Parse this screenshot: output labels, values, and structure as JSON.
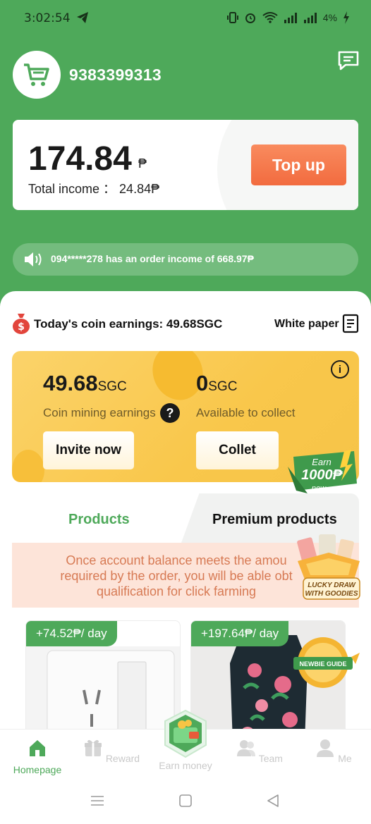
{
  "status": {
    "time": "3:02:54",
    "battery": "4%"
  },
  "header": {
    "phone": "9383399313"
  },
  "balance": {
    "amount": "174.84",
    "unit": "₱",
    "total_income": "Total income ： 24.84₱",
    "topup_label": "Top up"
  },
  "notice": {
    "text": "094*****278 has an order income of 668.97₱"
  },
  "coins": {
    "title": "Today's coin earnings: 49.68SGC",
    "white_paper": "White paper",
    "mining_amount": "49.68",
    "collect_amount": "0",
    "unit": "SGC",
    "mining_label": "Coin mining earnings",
    "collect_label": "Available to collect",
    "invite_label": "Invite now",
    "collect_button": "Collet",
    "earn_badge": {
      "line1": "Earn",
      "line2": "1000₱",
      "line3": "now"
    }
  },
  "tabs": {
    "products": "Products",
    "premium": "Premium products"
  },
  "info": {
    "line1": "Once account balance meets the amou",
    "line2": "required by the order, you will be able obt",
    "line3": "qualification for click farming"
  },
  "lucky_draw": {
    "line1": "LUCKY DRAW",
    "line2": "WITH GOODIES"
  },
  "newbie": "NEWBIE GUIDE",
  "products": [
    {
      "price": "+74.52₱/ day"
    },
    {
      "price": "+197.64₱/ day"
    }
  ],
  "nav": {
    "homepage": "Homepage",
    "reward": "Reward",
    "earn": "Earn money",
    "team": "Team",
    "me": "Me"
  },
  "colors": {
    "primary": "#4ea95a",
    "accent": "#f26b3f",
    "gold": "#f9c74b"
  }
}
